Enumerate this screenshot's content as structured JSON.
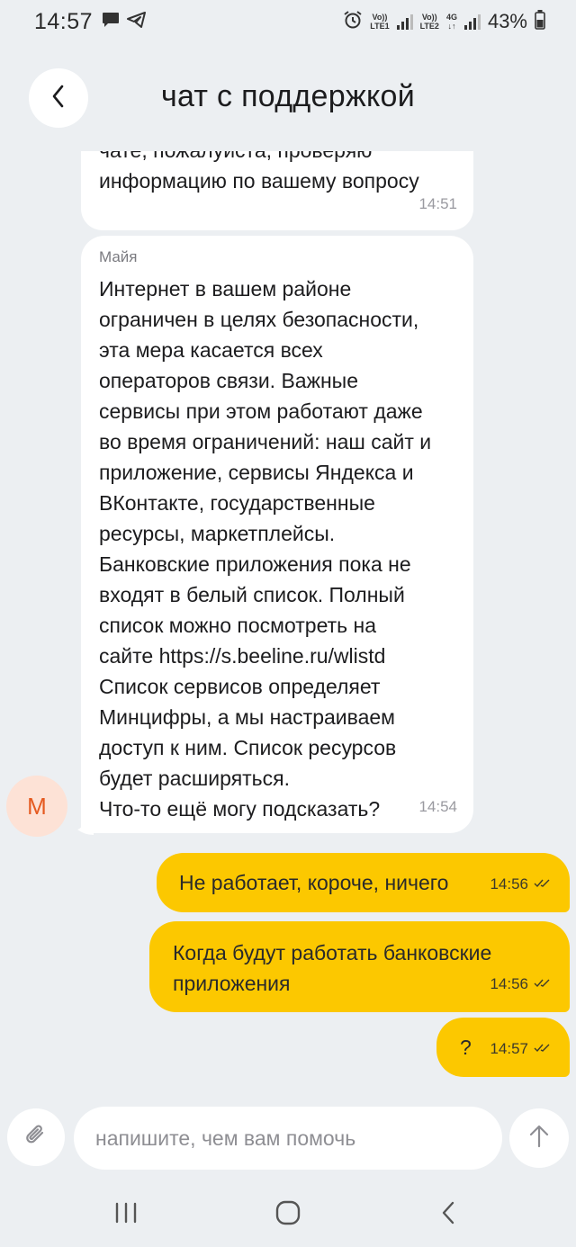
{
  "status_bar": {
    "time": "14:57",
    "sim1_label_top": "Vo))",
    "sim1_label_bottom": "LTE1",
    "sim2_label_top": "Vo))",
    "sim2_label_bottom": "LTE2",
    "network_label": "4G",
    "battery": "43%",
    "icons": [
      "chat-icon",
      "telegram-icon",
      "alarm-icon",
      "signal-icon",
      "battery-icon"
    ]
  },
  "header": {
    "title": "чат с поддержкой",
    "back_icon": "chevron-left-icon"
  },
  "messages": [
    {
      "direction": "in",
      "text": "чате, пожалуйста, проверяю\nинформацию по вашему вопросу",
      "time": "14:51"
    },
    {
      "direction": "in",
      "sender": "Майя",
      "text": "Интернет в вашем районе\nограничен в целях безопасности,\nэта мера касается всех\nоператоров связи. Важные\nсервисы при этом работают даже\nво время ограничений: наш сайт и\nприложение, сервисы Яндекса и\nВКонтакте, государственные\nресурсы, маркетплейсы.\nБанковские приложения пока не\nвходят в белый список. Полный\nсписок можно посмотреть на\nсайте https://s.beeline.ru/wlistd\nСписок сервисов определяет\nМинцифры, а мы настраиваем\nдоступ к ним.  Список ресурсов\nбудет расширяться.\nЧто-то ещё могу подсказать?",
      "time": "14:54",
      "avatar_letter": "М"
    },
    {
      "direction": "out",
      "text": "Не работает, короче, ничего",
      "time": "14:56",
      "status_icon": "double-check-icon"
    },
    {
      "direction": "out",
      "text": "Когда будут работать банковские\nприложения",
      "time": "14:56",
      "status_icon": "double-check-icon"
    },
    {
      "direction": "out",
      "text": "?",
      "time": "14:57",
      "status_icon": "double-check-icon"
    }
  ],
  "composer": {
    "placeholder": "напишите, чем вам помочь",
    "value": "",
    "attach_icon": "paperclip-icon",
    "send_icon": "arrow-up-icon"
  },
  "nav_bar": {
    "icons": [
      "recents-icon",
      "home-icon",
      "back-icon"
    ]
  },
  "colors": {
    "background": "#eceff2",
    "outgoing_bubble": "#fcc800",
    "incoming_bubble": "#ffffff",
    "avatar_bg": "#fde2d6",
    "avatar_text": "#e55a20"
  }
}
